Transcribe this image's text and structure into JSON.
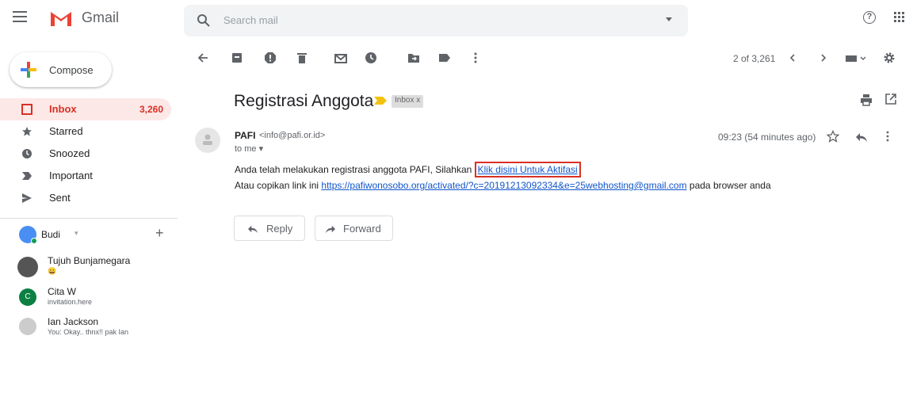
{
  "app": {
    "name": "Gmail"
  },
  "search": {
    "placeholder": "Search mail"
  },
  "compose": {
    "label": "Compose"
  },
  "nav": [
    {
      "label": "Inbox",
      "count": "3,260",
      "active": true,
      "icon": "inbox-icon"
    },
    {
      "label": "Starred",
      "icon": "star-icon"
    },
    {
      "label": "Snoozed",
      "icon": "clock-icon"
    },
    {
      "label": "Important",
      "icon": "important-icon"
    },
    {
      "label": "Sent",
      "icon": "send-icon"
    }
  ],
  "hangouts": {
    "me": "Budi",
    "contacts": [
      {
        "name": "Tujuh Bunjamegara",
        "status": "😀"
      },
      {
        "name": "Cita W",
        "status": "invitation.here"
      },
      {
        "name": "Ian Jackson",
        "status": "You: Okay.. thnx!! pak Ian"
      }
    ]
  },
  "toolbar": {
    "pager": "2 of 3,261"
  },
  "email": {
    "subject": "Registrasi Anggota",
    "label_chip": "Inbox x",
    "sender_name": "PAFI",
    "sender_email": "<info@pafi.or.id>",
    "to": "to me ▾",
    "time": "09:23 (54 minutes ago)",
    "line1_text": "Anda telah melakukan registrasi anggota PAFI, Silahkan ",
    "line1_link": "Klik disini Untuk Aktifasi",
    "line2_text": "Atau copikan link ini ",
    "line2_link": "https://pafiwonosobo.org/activated/?c=20191213092334&e=25webhosting@gmail.com",
    "line2_suffix": " pada browser anda"
  },
  "actions": {
    "reply": "Reply",
    "forward": "Forward"
  },
  "colors": {
    "accent_red": "#d93025",
    "link": "#1155cc",
    "important": "#f4c20d"
  }
}
